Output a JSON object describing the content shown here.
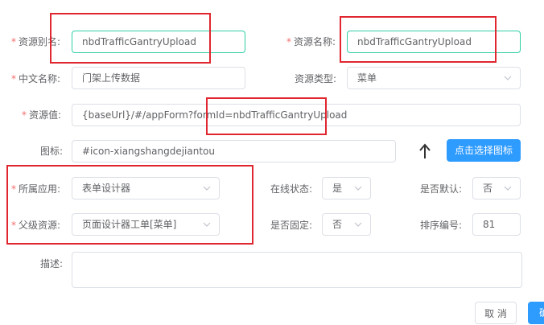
{
  "fields": {
    "alias": {
      "label": "资源别名:",
      "value": "nbdTrafficGantryUpload"
    },
    "name": {
      "label": "资源名称:",
      "value": "nbdTrafficGantryUpload"
    },
    "cn_name": {
      "label": "中文名称:",
      "value": "门架上传数据"
    },
    "type": {
      "label": "资源类型:",
      "value": "菜单"
    },
    "resource_value": {
      "label": "资源值:",
      "value": "{baseUrl}/#/appForm?formId=nbdTrafficGantryUpload"
    },
    "icon": {
      "label": "图标:",
      "value": "#icon-xiangshangdejiantou",
      "button": "点击选择图标"
    },
    "app": {
      "label": "所属应用:",
      "value": "表单设计器"
    },
    "online": {
      "label": "在线状态:",
      "value": "是"
    },
    "is_default": {
      "label": "是否默认:",
      "value": "否"
    },
    "parent": {
      "label": "父级资源:",
      "value": "页面设计器工单[菜单]"
    },
    "fixed": {
      "label": "是否固定:",
      "value": "否"
    },
    "sort": {
      "label": "排序编号:",
      "value": "81"
    },
    "desc": {
      "label": "描述:",
      "value": ""
    }
  },
  "footer": {
    "cancel": "取 消",
    "confirm": "确"
  },
  "icon_preview": "arrow-up-icon",
  "colors": {
    "required": "#f56c6c",
    "primary": "#2e9bff",
    "focus_border": "#2fcfa5",
    "highlight": "#e0262f"
  }
}
